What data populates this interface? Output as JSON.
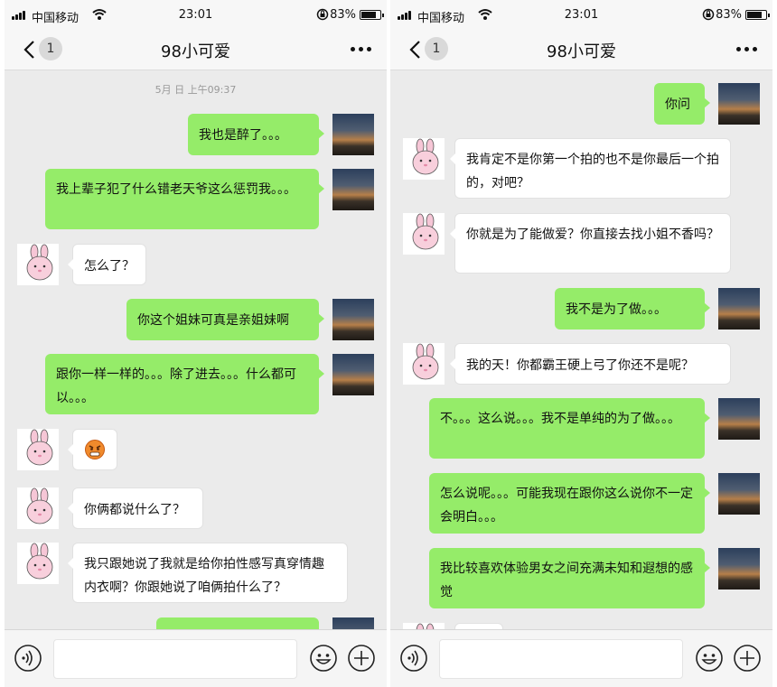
{
  "status": {
    "carrier": "中国移动",
    "time": "23:01",
    "battery": "83%"
  },
  "nav": {
    "unread": "1",
    "title": "98小可爱"
  },
  "chat1": {
    "timestamp": "5月 日 上午09:37",
    "messages": [
      {
        "from": "me",
        "text": "我也是醉了。。。"
      },
      {
        "from": "me",
        "text": "我上辈子犯了什么错老天爷这么惩罚我。。。"
      },
      {
        "from": "them",
        "text": "怎么了？"
      },
      {
        "from": "me",
        "text": "你这个姐妹可真是亲姐妹啊"
      },
      {
        "from": "me",
        "text": "跟你一样一样的。。。除了进去。。。什么都可以。。。"
      },
      {
        "from": "them",
        "emoji": "angry-face"
      },
      {
        "from": "them",
        "text": "你俩都说什么了？"
      },
      {
        "from": "them",
        "text": "我只跟她说了我就是给你拍性感写真穿情趣内衣啊？你跟她说了咱俩拍什么了？"
      },
      {
        "from": "me",
        "text": ""
      }
    ]
  },
  "chat2": {
    "messages": [
      {
        "from": "me",
        "text": "你问"
      },
      {
        "from": "them",
        "text": "我肯定不是你第一个拍的也不是你最后一个拍的，对吧？"
      },
      {
        "from": "them",
        "text": "你就是为了能做爱？你直接去找小姐不香吗？"
      },
      {
        "from": "me",
        "text": "我不是为了做。。。"
      },
      {
        "from": "them",
        "text": "我的天！你都霸王硬上弓了你还不是呢？"
      },
      {
        "from": "me",
        "text": "不。。。这么说。。。我不是单纯的为了做。。。"
      },
      {
        "from": "me",
        "text": "怎么说呢。。。可能我现在跟你这么说你不一定会明白。。。"
      },
      {
        "from": "me",
        "text": "我比较喜欢体验男女之间充满未知和遐想的感觉"
      },
      {
        "from": "them",
        "text": ""
      }
    ]
  },
  "colors": {
    "bubble_me": "#95ec69",
    "bubble_them": "#ffffff",
    "chat_bg": "#ebebeb"
  },
  "icons": [
    "signal-icon",
    "wifi-icon",
    "rotation-lock-icon",
    "battery-icon",
    "back-chevron-icon",
    "more-icon",
    "voice-icon",
    "emoji-icon",
    "plus-icon",
    "angry-face-icon"
  ]
}
